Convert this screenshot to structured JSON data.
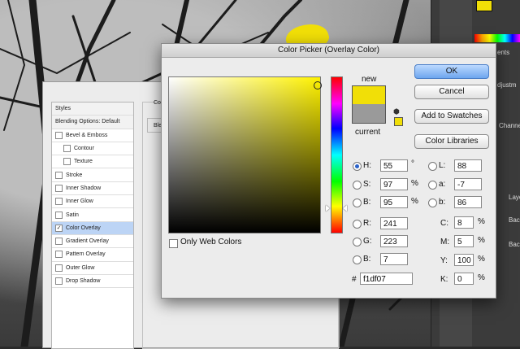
{
  "picker": {
    "title": "Color Picker (Overlay Color)",
    "ok_label": "OK",
    "cancel_label": "Cancel",
    "add_swatches_label": "Add to Swatches",
    "color_libraries_label": "Color Libraries",
    "new_label": "new",
    "current_label": "current",
    "only_web_colors_label": "Only Web Colors",
    "new_color": "#f1df07",
    "current_color": "#9a9a9a",
    "hsb": {
      "h": {
        "label": "H:",
        "value": "55",
        "unit": "°"
      },
      "s": {
        "label": "S:",
        "value": "97",
        "unit": "%"
      },
      "b": {
        "label": "B:",
        "value": "95",
        "unit": "%"
      }
    },
    "rgb": {
      "r": {
        "label": "R:",
        "value": "241"
      },
      "g": {
        "label": "G:",
        "value": "223"
      },
      "b": {
        "label": "B:",
        "value": "7"
      }
    },
    "lab": {
      "l": {
        "label": "L:",
        "value": "88"
      },
      "a": {
        "label": "a:",
        "value": "-7"
      },
      "b": {
        "label": "b:",
        "value": "86"
      }
    },
    "cmyk": {
      "c": {
        "label": "C:",
        "value": "8",
        "unit": "%"
      },
      "m": {
        "label": "M:",
        "value": "5",
        "unit": "%"
      },
      "y": {
        "label": "Y:",
        "value": "100",
        "unit": "%"
      },
      "k": {
        "label": "K:",
        "value": "0",
        "unit": "%"
      }
    },
    "hex_label": "#",
    "hex_value": "f1df07"
  },
  "layer_style": {
    "styles_header": "Styles",
    "blending_options": "Blending Options: Default",
    "items": [
      {
        "label": "Bevel & Emboss",
        "indent": false,
        "checked": false
      },
      {
        "label": "Contour",
        "indent": true,
        "checked": false
      },
      {
        "label": "Texture",
        "indent": true,
        "checked": false
      },
      {
        "label": "Stroke",
        "indent": false,
        "checked": false
      },
      {
        "label": "Inner Shadow",
        "indent": false,
        "checked": false
      },
      {
        "label": "Inner Glow",
        "indent": false,
        "checked": false
      },
      {
        "label": "Satin",
        "indent": false,
        "checked": false
      },
      {
        "label": "Color Overlay",
        "indent": false,
        "checked": true
      },
      {
        "label": "Gradient Overlay",
        "indent": false,
        "checked": false
      },
      {
        "label": "Pattern Overlay",
        "indent": false,
        "checked": false
      },
      {
        "label": "Outer Glow",
        "indent": false,
        "checked": false
      },
      {
        "label": "Drop Shadow",
        "indent": false,
        "checked": false
      }
    ],
    "mid_label_1": "Co",
    "mid_label_2": "Ble"
  },
  "ps_panels": {
    "tab_ents": "ents",
    "tab_adjust": "djustm",
    "tab_channel": "Channe",
    "layer_1": "Laye",
    "layer_2": "Back",
    "layer_3": "Back",
    "fg_color": "#f1df07"
  }
}
